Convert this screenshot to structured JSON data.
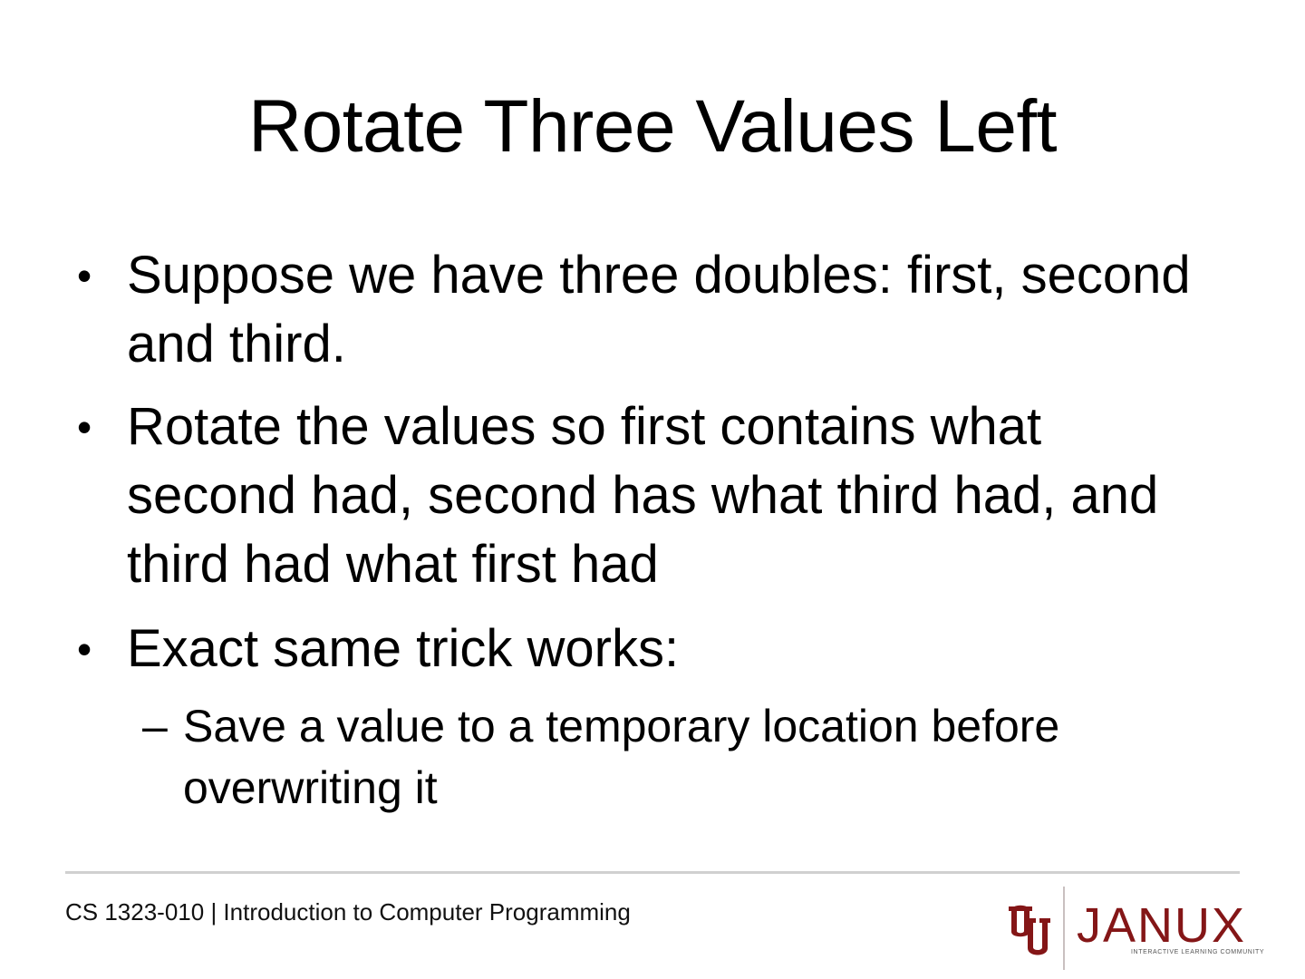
{
  "slide": {
    "title": "Rotate Three Values Left",
    "bullets": [
      "Suppose we have three doubles: first, second and third.",
      "Rotate the values so first contains what second had, second has what third had, and third had what first had",
      "Exact same trick works:"
    ],
    "sub_bullets": [
      "Save a value to a temporary location before overwriting it"
    ],
    "bullet_glyph": "•",
    "sub_bullet_glyph": "–"
  },
  "footer": {
    "course": "CS 1323-010 | Introduction to Computer Programming",
    "logo_text": "JANUX",
    "logo_tagline": "INTERACTIVE LEARNING COMMUNITY",
    "brand_color": "#841617"
  }
}
